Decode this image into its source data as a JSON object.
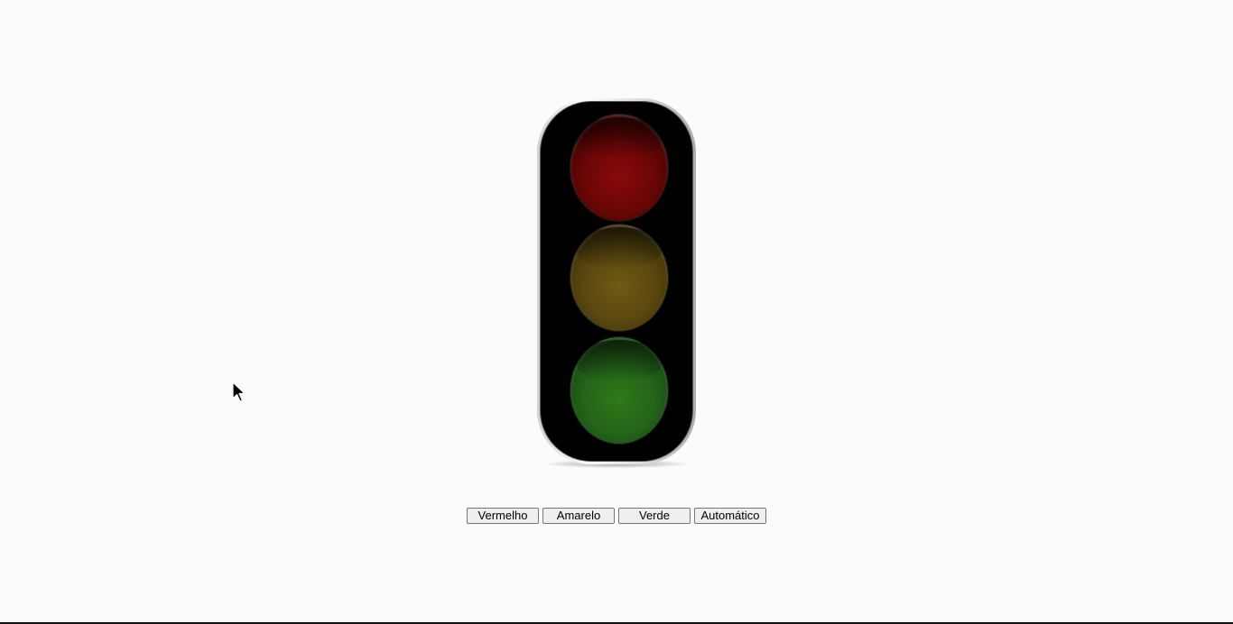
{
  "traffic_light": {
    "lamps": [
      {
        "name": "red",
        "color": "#6a0606",
        "state": "off"
      },
      {
        "name": "yellow",
        "color": "#5b480f",
        "state": "off"
      },
      {
        "name": "green",
        "color": "#25641a",
        "state": "off"
      }
    ]
  },
  "controls": {
    "red_label": "Vermelho",
    "yellow_label": "Amarelo",
    "green_label": "Verde",
    "auto_label": "Automático"
  },
  "icons": {
    "cursor": "mouse-pointer-icon"
  }
}
